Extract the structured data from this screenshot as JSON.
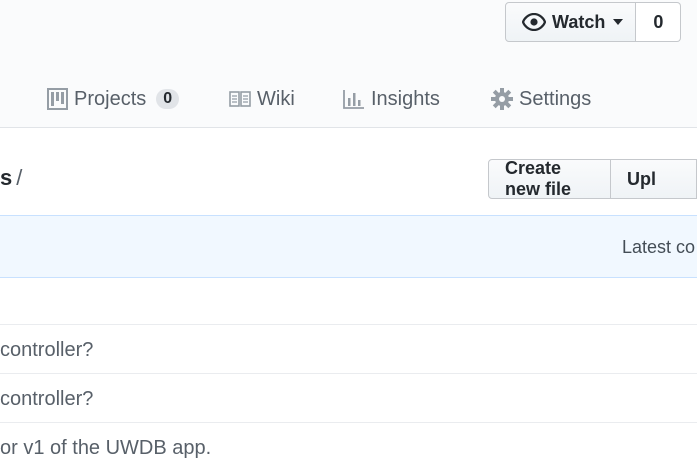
{
  "header": {
    "watch": {
      "label": "Watch",
      "count": "0"
    },
    "tabs": [
      {
        "id": "projects",
        "label": "Projects",
        "counter": "0"
      },
      {
        "id": "wiki",
        "label": "Wiki"
      },
      {
        "id": "insights",
        "label": "Insights"
      },
      {
        "id": "settings",
        "label": "Settings"
      }
    ]
  },
  "path": {
    "repo": "s",
    "separator": "/"
  },
  "file_actions": {
    "create": "Create new file",
    "upload": "Upl"
  },
  "commit": {
    "latest": "Latest co"
  },
  "rows": [
    {
      "message": ""
    },
    {
      "message": "controller?"
    },
    {
      "message": "controller?"
    },
    {
      "message": "or v1 of the UWDB app."
    }
  ]
}
